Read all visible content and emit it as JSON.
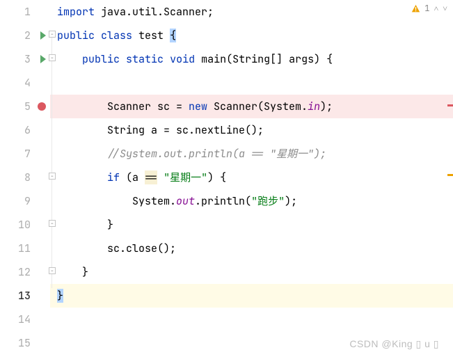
{
  "top_indicator": {
    "warning_count": "1"
  },
  "gutter_numbers": [
    "1",
    "2",
    "3",
    "4",
    "5",
    "6",
    "7",
    "8",
    "9",
    "10",
    "11",
    "12",
    "13",
    "14",
    "15"
  ],
  "caret_line_index": 12,
  "run_markers": [
    1,
    2
  ],
  "breakpoint_markers": [
    4
  ],
  "code": {
    "l1": {
      "kw": "import",
      "rest": " java.util.Scanner;"
    },
    "l2": {
      "kw1": "public",
      "kw2": "class",
      "name": " test ",
      "brace": "{"
    },
    "l3": {
      "kw1": "public",
      "kw2": "static",
      "kw3": "void",
      "sig": " main(String[] args) {"
    },
    "l5": {
      "t1": "Scanner sc = ",
      "kw": "new",
      "t2": " Scanner(System.",
      "field": "in",
      "t3": ");"
    },
    "l6": "String a = sc.nextLine();",
    "l7": "//System.out.println(a == \"星期一\");",
    "l8": {
      "t1": "if ",
      "paren": "(a ",
      "op": "==",
      "sp": " ",
      "str": "\"星期一\"",
      "close": ") {"
    },
    "l9": {
      "t1": "System.",
      "field": "out",
      "t2": ".println(",
      "str": "\"跑步\"",
      "t3": ");"
    },
    "l10": "}",
    "l11": "sc.close();",
    "l12": "}",
    "l13": "}"
  },
  "watermark": "CSDN @King ▯ u ▯",
  "chart_data": {
    "type": "table",
    "title": "Java source code (IntelliJ editor)",
    "lines": [
      "import java.util.Scanner;",
      "public class test {",
      "    public static void main(String[] args) {",
      "",
      "        Scanner sc = new Scanner(System.in);",
      "        String a = sc.nextLine();",
      "        //System.out.println(a == \"星期一\");",
      "        if (a == \"星期一\") {",
      "            System.out.println(\"跑步\");",
      "        }",
      "        sc.close();",
      "    }",
      "}",
      "",
      ""
    ],
    "breakpoints": [
      5
    ],
    "runnable_lines": [
      2,
      3
    ],
    "warnings_count": 1,
    "caret_line": 13
  }
}
